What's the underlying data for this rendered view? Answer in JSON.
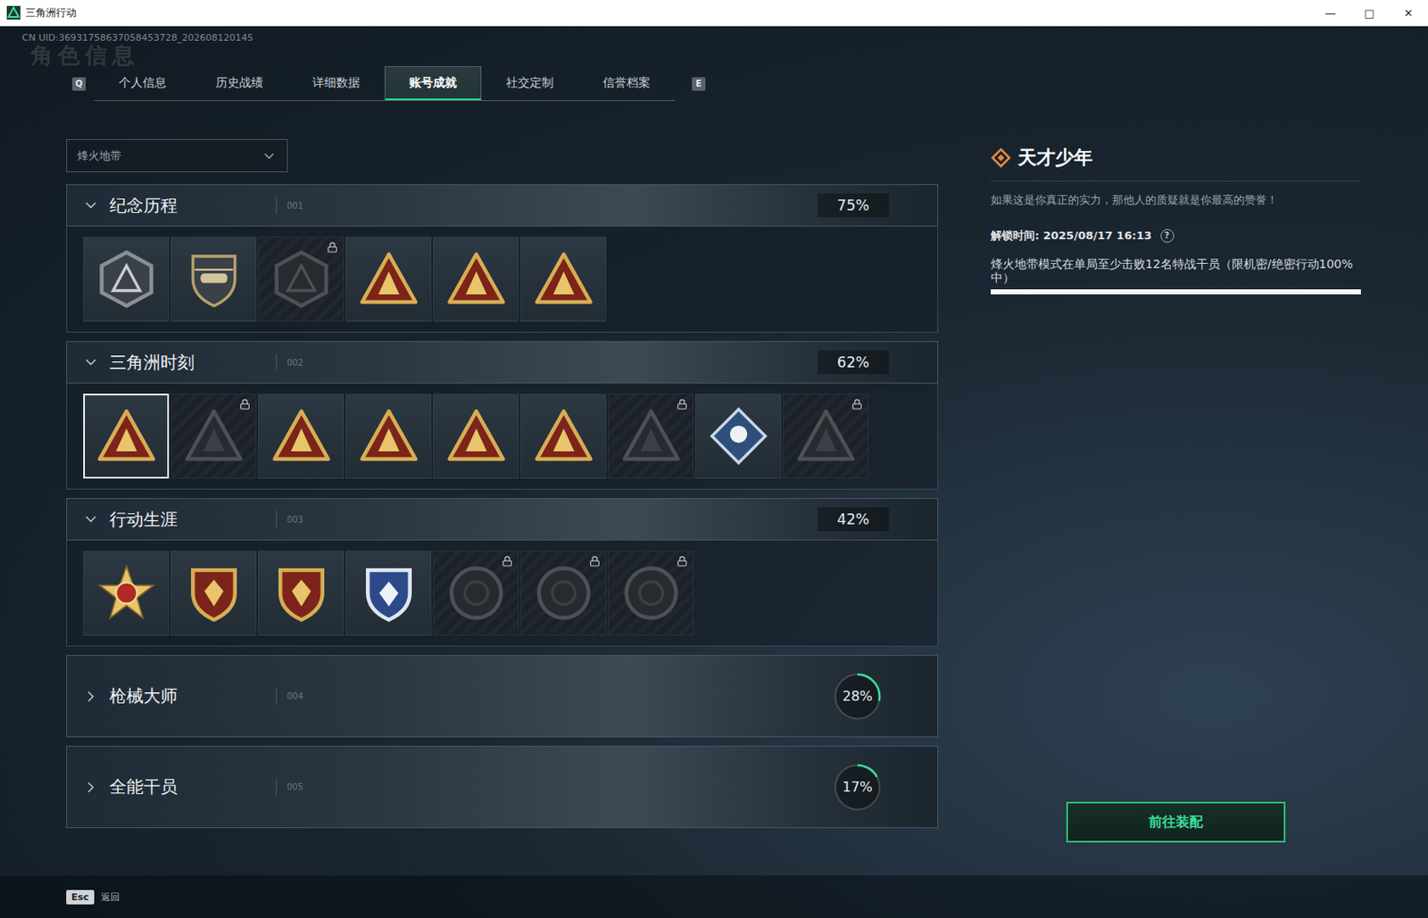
{
  "window": {
    "title": "三角洲行动",
    "controls": [
      "—",
      "□",
      "✕"
    ]
  },
  "uid": "CN UID:36931758637058453728_202608120145",
  "watermark": "角色信息",
  "tabs": {
    "prev_key": "Q",
    "next_key": "E",
    "items": [
      {
        "label": "个人信息",
        "selected": false
      },
      {
        "label": "历史战绩",
        "selected": false
      },
      {
        "label": "详细数据",
        "selected": false
      },
      {
        "label": "账号成就",
        "selected": true
      },
      {
        "label": "社交定制",
        "selected": false
      },
      {
        "label": "信誉档案",
        "selected": false
      }
    ]
  },
  "mode_select": {
    "value": "烽火地带"
  },
  "categories": [
    {
      "title": "纪念历程",
      "index": "001",
      "expanded": true,
      "percent": "75%",
      "badges": [
        {
          "kind": "hex",
          "locked": false,
          "selected": false
        },
        {
          "kind": "heli",
          "locked": false,
          "selected": false
        },
        {
          "kind": "hex",
          "locked": true,
          "selected": false
        },
        {
          "kind": "triangle",
          "locked": false,
          "selected": false
        },
        {
          "kind": "triangle",
          "locked": false,
          "selected": false
        },
        {
          "kind": "triangle",
          "locked": false,
          "selected": false
        }
      ]
    },
    {
      "title": "三角洲时刻",
      "index": "002",
      "expanded": true,
      "percent": "62%",
      "badges": [
        {
          "kind": "triangle",
          "locked": false,
          "selected": true
        },
        {
          "kind": "triangle",
          "locked": true,
          "selected": false
        },
        {
          "kind": "triangle",
          "locked": false,
          "selected": false
        },
        {
          "kind": "triangle",
          "locked": false,
          "selected": false
        },
        {
          "kind": "triangle",
          "locked": false,
          "selected": false
        },
        {
          "kind": "triangle",
          "locked": false,
          "selected": false
        },
        {
          "kind": "triangle",
          "locked": true,
          "selected": false
        },
        {
          "kind": "diamond",
          "locked": false,
          "selected": false
        },
        {
          "kind": "triangle",
          "locked": true,
          "selected": false
        }
      ]
    },
    {
      "title": "行动生涯",
      "index": "003",
      "expanded": true,
      "percent": "42%",
      "badges": [
        {
          "kind": "medal",
          "locked": false,
          "selected": false
        },
        {
          "kind": "shield",
          "locked": false,
          "selected": false
        },
        {
          "kind": "shield",
          "locked": false,
          "selected": false
        },
        {
          "kind": "crest",
          "locked": false,
          "selected": false
        },
        {
          "kind": "round",
          "locked": true,
          "selected": false
        },
        {
          "kind": "round",
          "locked": true,
          "selected": false
        },
        {
          "kind": "round",
          "locked": true,
          "selected": false
        }
      ]
    },
    {
      "title": "枪械大师",
      "index": "004",
      "expanded": false,
      "percent": "28%",
      "level": 0.28
    },
    {
      "title": "全能干员",
      "index": "005",
      "expanded": false,
      "percent": "17%",
      "level": 0.17
    }
  ],
  "detail": {
    "title": "天才少年",
    "description": "如果这是你真正的实力，那他人的质疑就是你最高的赞誉！",
    "unlock_time": "解锁时间: 2025/08/17 16:13",
    "help": "?",
    "condition": "烽火地带模式在单局至少击败12名特战干员（限机密/绝密行动100%中）",
    "level": 1,
    "button": "前往装配"
  },
  "footer": {
    "key": "Esc",
    "label": "返回"
  }
}
